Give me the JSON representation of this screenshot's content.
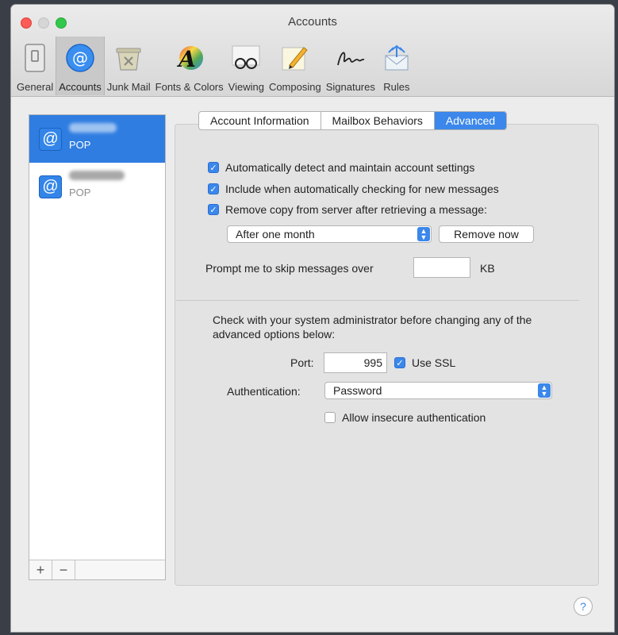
{
  "window": {
    "title": "Accounts"
  },
  "toolbar": {
    "items": [
      {
        "label": "General",
        "icon": "general-icon"
      },
      {
        "label": "Accounts",
        "icon": "at-icon"
      },
      {
        "label": "Junk Mail",
        "icon": "junk-mail-icon"
      },
      {
        "label": "Fonts & Colors",
        "icon": "fonts-colors-icon"
      },
      {
        "label": "Viewing",
        "icon": "glasses-icon"
      },
      {
        "label": "Composing",
        "icon": "composing-icon"
      },
      {
        "label": "Signatures",
        "icon": "signature-icon"
      },
      {
        "label": "Rules",
        "icon": "rules-icon"
      }
    ],
    "active": "Accounts"
  },
  "sidebar": {
    "accounts": [
      {
        "type": "POP",
        "selected": true
      },
      {
        "type": "POP",
        "selected": false
      }
    ],
    "add_label": "+",
    "remove_label": "−"
  },
  "tabs": [
    {
      "label": "Account Information"
    },
    {
      "label": "Mailbox Behaviors"
    },
    {
      "label": "Advanced"
    }
  ],
  "advanced": {
    "auto_detect": {
      "label": "Automatically detect and maintain account settings",
      "checked": true
    },
    "include_checking": {
      "label": "Include when automatically checking for new messages",
      "checked": true
    },
    "remove_copy": {
      "label": "Remove copy from server after retrieving a message:",
      "checked": true
    },
    "remove_after": "After one month",
    "remove_now_label": "Remove now",
    "prompt_label": "Prompt me to skip messages over",
    "prompt_value": "",
    "prompt_unit": "KB",
    "admin_note": "Check with your system administrator before changing any of the advanced options below:",
    "port_label": "Port:",
    "port_value": "995",
    "use_ssl": {
      "label": "Use SSL",
      "checked": true
    },
    "auth_label": "Authentication:",
    "auth_value": "Password",
    "allow_insecure": {
      "label": "Allow insecure authentication",
      "checked": false
    }
  },
  "help_label": "?",
  "colors": {
    "accent": "#3b87eb",
    "selection": "#2f7de1"
  }
}
